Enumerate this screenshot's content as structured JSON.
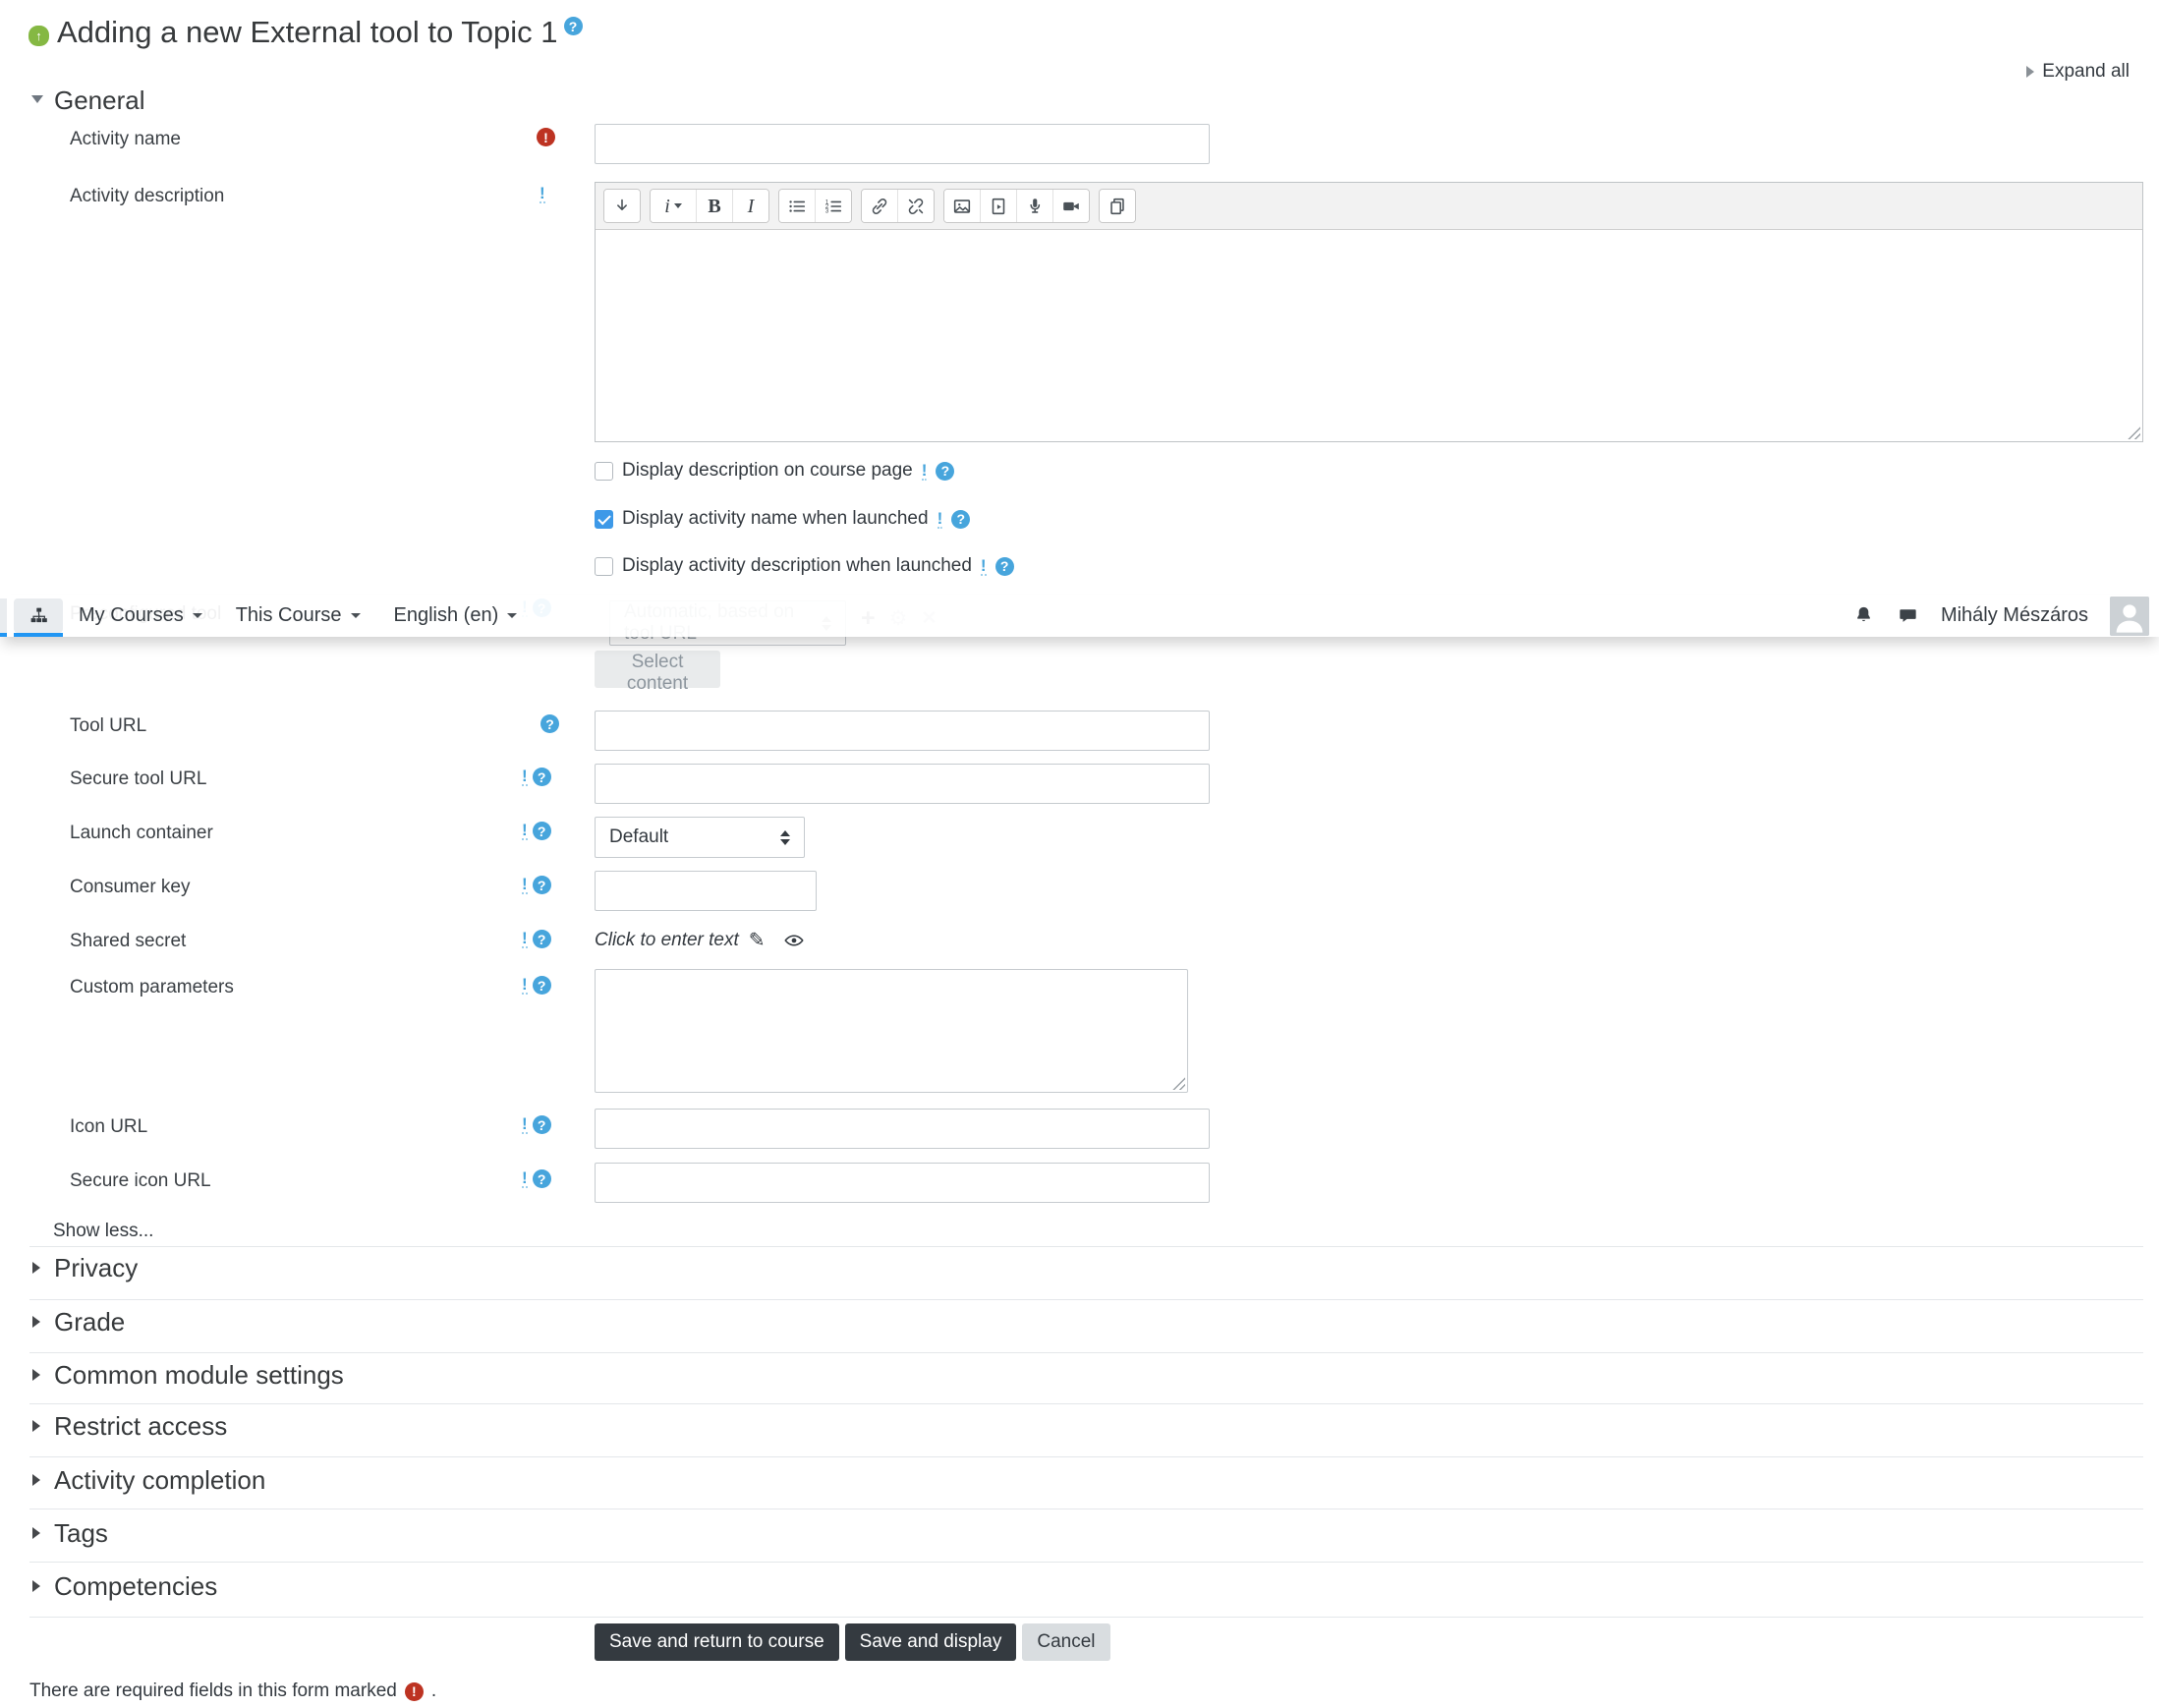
{
  "colors": {
    "accent_blue": "#2196f3",
    "help_blue": "#47a5dc",
    "required_red": "#bd3322",
    "checkbox_blue": "#3d99e8",
    "button_dark_bg": "#343a40",
    "button_light_bg": "#d9dde0",
    "disabled_text": "#9aa2a9",
    "tool_icon_green": "#85b843"
  },
  "header": {
    "title": "Adding a new External tool to Topic 1",
    "expand_all": "Expand all"
  },
  "navbar": {
    "menus": [
      {
        "label": "My Courses"
      },
      {
        "label": "This Course"
      },
      {
        "label": "English (en)"
      }
    ],
    "user_name": "Mihály Mészáros",
    "icon_names": [
      "sitemap-icon",
      "notifications-bell-icon",
      "messages-icon",
      "avatar"
    ]
  },
  "icons": {
    "help_glyph": "?",
    "required_glyph": "!",
    "advanced_glyph": "!",
    "pencil_glyph": "✎",
    "up_arrow_glyph": "↑",
    "plus_glyph": "+",
    "gear_glyph": "⚙",
    "x_glyph": "✕",
    "bold_glyph": "B",
    "italic_glyph": "I",
    "font_style_glyph": "i"
  },
  "general": {
    "heading": "General",
    "activity_name": {
      "label": "Activity name",
      "value": ""
    },
    "activity_description": {
      "label": "Activity description",
      "value": ""
    },
    "editor_toolbar": [
      "collapse-toolbar-icon",
      "font-style-icon",
      "bold-icon",
      "italic-icon",
      "unordered-list-icon",
      "ordered-list-icon",
      "link-icon",
      "unlink-icon",
      "image-icon",
      "media-icon",
      "record-audio-icon",
      "record-video-icon",
      "manage-files-icon"
    ],
    "checkboxes": [
      {
        "label": "Display description on course page",
        "checked": false
      },
      {
        "label": "Display activity name when launched",
        "checked": true
      },
      {
        "label": "Display activity description when launched",
        "checked": false
      }
    ],
    "preconfigured_tool": {
      "label": "Preconfigured tool",
      "select_value": "Automatic, based on tool URL",
      "select_content_button": "Select content"
    },
    "tool_url": {
      "label": "Tool URL",
      "value": ""
    },
    "secure_tool_url": {
      "label": "Secure tool URL",
      "value": ""
    },
    "launch_container": {
      "label": "Launch container",
      "value": "Default"
    },
    "consumer_key": {
      "label": "Consumer key",
      "value": ""
    },
    "shared_secret": {
      "label": "Shared secret",
      "value": "Click to enter text"
    },
    "custom_parameters": {
      "label": "Custom parameters",
      "value": ""
    },
    "icon_url": {
      "label": "Icon URL",
      "value": ""
    },
    "secure_icon_url": {
      "label": "Secure icon URL",
      "value": ""
    },
    "show_less": "Show less..."
  },
  "sections": [
    {
      "label": "Privacy"
    },
    {
      "label": "Grade"
    },
    {
      "label": "Common module settings"
    },
    {
      "label": "Restrict access"
    },
    {
      "label": "Activity completion"
    },
    {
      "label": "Tags"
    },
    {
      "label": "Competencies"
    }
  ],
  "actions": {
    "save_return": "Save and return to course",
    "save_display": "Save and display",
    "cancel": "Cancel"
  },
  "footer": {
    "required_note": "There are required fields in this form marked",
    "suffix": "."
  }
}
